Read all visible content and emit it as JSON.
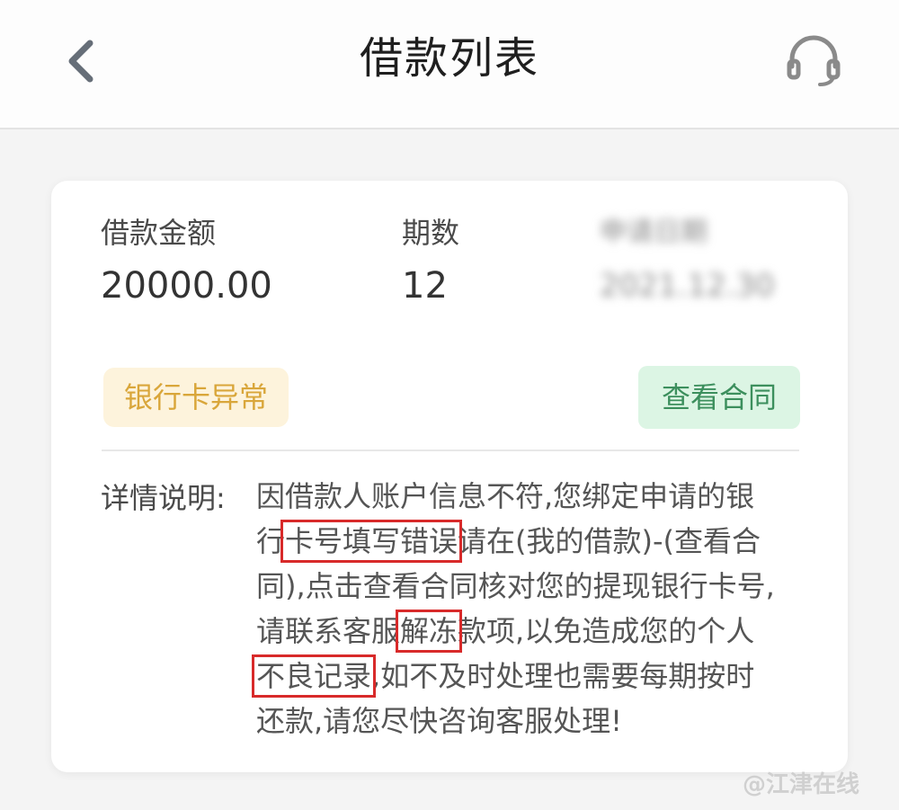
{
  "header": {
    "back_icon": "chevron-left-icon",
    "title": "借款列表",
    "service_icon": "headset-icon"
  },
  "loan": {
    "amount_label": "借款金额",
    "amount_value": "20000.00",
    "periods_label": "期数",
    "periods_value": "12",
    "blurred_label": "申请日期",
    "blurred_value": "2021.12.30"
  },
  "status_badge": "银行卡异常",
  "contract_button": "查看合同",
  "detail": {
    "label": "详情说明:",
    "lines": [
      [
        {
          "text": "因借款人账户信息不符,您绑定申请的银",
          "hl": false
        }
      ],
      [
        {
          "text": "行",
          "hl": false
        },
        {
          "text": "卡号填写错误",
          "hl": true
        },
        {
          "text": "请在(我的借款)-(查看合",
          "hl": false
        }
      ],
      [
        {
          "text": "同),点击查看合同核对您的提现银行卡号,",
          "hl": false
        }
      ],
      [
        {
          "text": "请联系客服",
          "hl": false
        },
        {
          "text": "解冻",
          "hl": true
        },
        {
          "text": "款项,以免造成您的个人",
          "hl": false
        }
      ],
      [
        {
          "text": "不良记录",
          "hl": true
        },
        {
          "text": ",如不及时处理也需要每期按时",
          "hl": false
        }
      ],
      [
        {
          "text": "还款,请您尽快咨询客服处理!",
          "hl": false
        }
      ]
    ]
  },
  "watermark": "@江津在线",
  "colors": {
    "badge_text": "#d9a63a",
    "badge_bg": "#fdf3dc",
    "contract_text": "#3c8f5d",
    "contract_bg": "#dcf5e4",
    "highlight_box": "#d82a2a"
  }
}
